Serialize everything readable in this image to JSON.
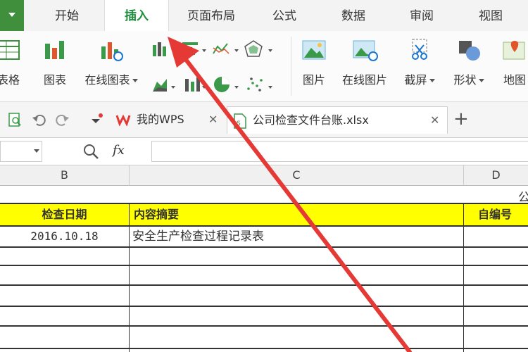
{
  "ribbon_tabs": [
    "开始",
    "插入",
    "页面布局",
    "公式",
    "数据",
    "审阅",
    "视图"
  ],
  "active_tab": "插入",
  "ribbon": {
    "table_label": "表格",
    "chart_label": "图表",
    "online_chart_label": "在线图表",
    "picture_label": "图片",
    "online_picture_label": "在线图片",
    "screenshot_label": "截屏",
    "shapes_label": "形状",
    "map_label": "地图"
  },
  "doc_tabs": [
    {
      "label": "我的WPS"
    },
    {
      "label": "公司检查文件台账.xlsx"
    }
  ],
  "formula_bar": {
    "fx_label": "fx",
    "value": ""
  },
  "columns": [
    "B",
    "C",
    "D"
  ],
  "header_row": {
    "b": "检查日期",
    "c": "内容摘要",
    "d": "自编号"
  },
  "partial_title_char": "公",
  "rows": [
    {
      "b": "2016.10.18",
      "c": "安全生产检查过程记录表",
      "d": ""
    },
    {
      "b": "",
      "c": "",
      "d": ""
    },
    {
      "b": "",
      "c": "",
      "d": ""
    },
    {
      "b": "",
      "c": "",
      "d": ""
    },
    {
      "b": "",
      "c": "",
      "d": ""
    },
    {
      "b": "",
      "c": "",
      "d": ""
    }
  ],
  "colors": {
    "accent": "#1f8e3d",
    "header_fill": "#ffff00",
    "annotation_arrow": "#e53935"
  }
}
